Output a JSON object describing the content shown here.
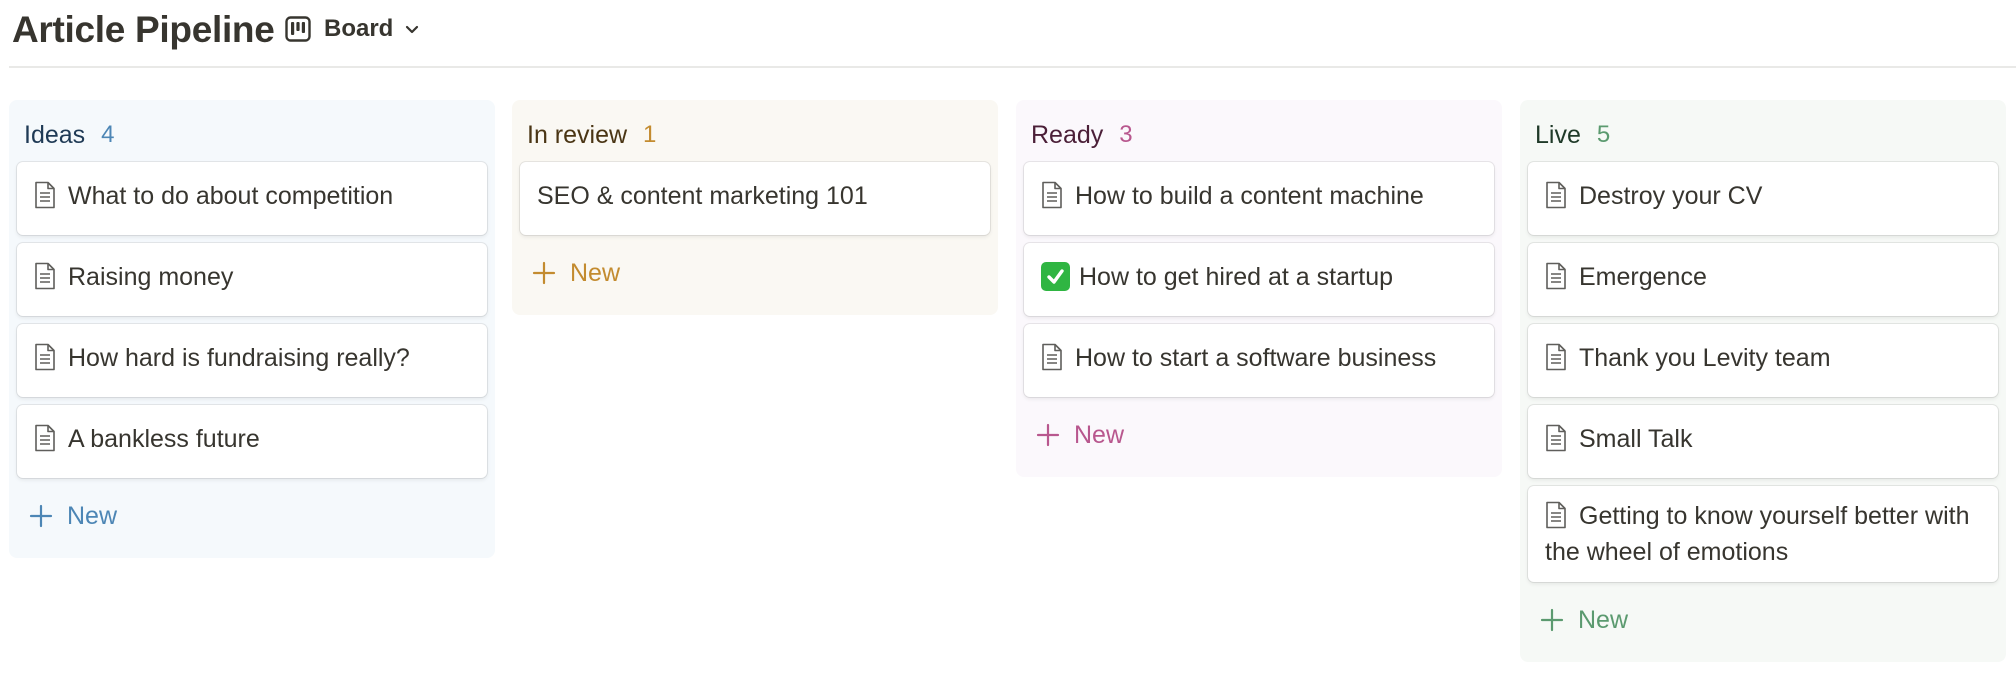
{
  "page": {
    "title": "Article Pipeline"
  },
  "view": {
    "label": "Board",
    "icon": "board-icon",
    "chevron": "chevron-down-icon"
  },
  "columns": [
    {
      "title": "Ideas",
      "count": "4",
      "new_label": "New",
      "bg": "#f5f9fc",
      "title_color": "#1f3a55",
      "accent": "#4d86b5",
      "cards": [
        {
          "title": "What to do about competition",
          "icon": "document-icon"
        },
        {
          "title": "Raising money",
          "icon": "document-icon"
        },
        {
          "title": "How hard is fundraising really?",
          "icon": "document-icon"
        },
        {
          "title": "A bankless future",
          "icon": "document-icon"
        }
      ]
    },
    {
      "title": "In review",
      "count": "1",
      "new_label": "New",
      "bg": "#faf8f3",
      "title_color": "#4a3514",
      "accent": "#c38b2f",
      "cards": [
        {
          "title": "SEO & content marketing 101",
          "icon": ""
        }
      ]
    },
    {
      "title": "Ready",
      "count": "3",
      "new_label": "New",
      "bg": "#fbf8fc",
      "title_color": "#4b1f38",
      "accent": "#b8578e",
      "cards": [
        {
          "title": "How to build a content machine",
          "icon": "document-icon"
        },
        {
          "title": "How to get hired at a startup",
          "icon": "check-mark-icon"
        },
        {
          "title": "How to start a software business",
          "icon": "document-icon"
        }
      ]
    },
    {
      "title": "Live",
      "count": "5",
      "new_label": "New",
      "bg": "#f6f9f6",
      "title_color": "#1f3a28",
      "accent": "#5b9a6f",
      "cards": [
        {
          "title": "Destroy your CV",
          "icon": "document-icon"
        },
        {
          "title": "Emergence",
          "icon": "document-icon"
        },
        {
          "title": "Thank you Levity team",
          "icon": "document-icon"
        },
        {
          "title": "Small Talk",
          "icon": "document-icon"
        },
        {
          "title": "Getting to know yourself better with the wheel of emotions",
          "icon": "document-icon"
        }
      ]
    }
  ]
}
